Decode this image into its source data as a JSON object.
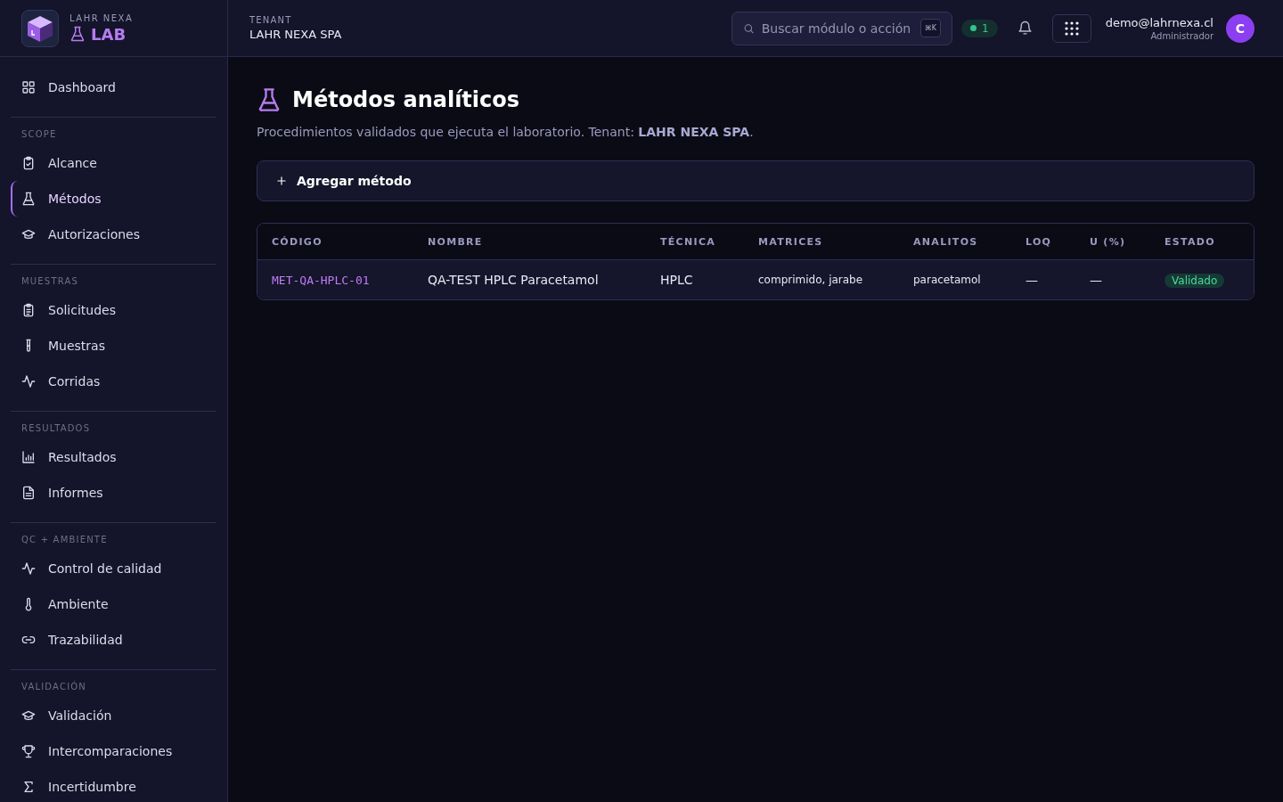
{
  "brand": {
    "company": "LAHR NEXA",
    "product": "LAB"
  },
  "sidebar": {
    "sections": [
      {
        "items": [
          {
            "label": "Dashboard",
            "selected": false
          }
        ]
      },
      {
        "title": "SCOPE",
        "items": [
          {
            "label": "Alcance",
            "selected": false
          },
          {
            "label": "Métodos",
            "selected": true
          },
          {
            "label": "Autorizaciones",
            "selected": false
          }
        ]
      },
      {
        "title": "MUESTRAS",
        "items": [
          {
            "label": "Solicitudes",
            "selected": false
          },
          {
            "label": "Muestras",
            "selected": false
          },
          {
            "label": "Corridas",
            "selected": false
          }
        ]
      },
      {
        "title": "RESULTADOS",
        "items": [
          {
            "label": "Resultados",
            "selected": false
          },
          {
            "label": "Informes",
            "selected": false
          }
        ]
      },
      {
        "title": "QC + AMBIENTE",
        "items": [
          {
            "label": "Control de calidad",
            "selected": false
          },
          {
            "label": "Ambiente",
            "selected": false
          },
          {
            "label": "Trazabilidad",
            "selected": false
          }
        ]
      },
      {
        "title": "VALIDACIÓN",
        "items": [
          {
            "label": "Validación",
            "selected": false
          },
          {
            "label": "Intercomparaciones",
            "selected": false
          },
          {
            "label": "Incertidumbre",
            "selected": false
          }
        ]
      }
    ]
  },
  "header": {
    "tenant_label": "TENANT",
    "tenant": "LAHR NEXA SPA",
    "search": {
      "placeholder": "Buscar módulo o acción",
      "shortcut": "⌘K"
    },
    "status_count": "1",
    "user": {
      "email": "demo@lahrnexa.cl",
      "role": "Administrador",
      "initial": "C"
    }
  },
  "page": {
    "title": "Métodos analíticos",
    "subtitle": "Procedimientos validados que ejecuta el laboratorio. Tenant: **LAHR NEXA SPA**.",
    "add_button": "Agregar método"
  },
  "table": {
    "columns": [
      "CÓDIGO",
      "NOMBRE",
      "TÉCNICA",
      "MATRICES",
      "ANALITOS",
      "LOQ",
      "U (%)",
      "ESTADO"
    ],
    "rows": [
      {
        "code": "MET-QA-HPLC-01",
        "name": "QA-TEST HPLC Paracetamol",
        "technique": "HPLC",
        "matrices": "comprimido, jarabe",
        "analytes": "paracetamol",
        "loq": "—",
        "u": "—",
        "status": {
          "label": "Validado",
          "kind": "success"
        }
      }
    ]
  }
}
